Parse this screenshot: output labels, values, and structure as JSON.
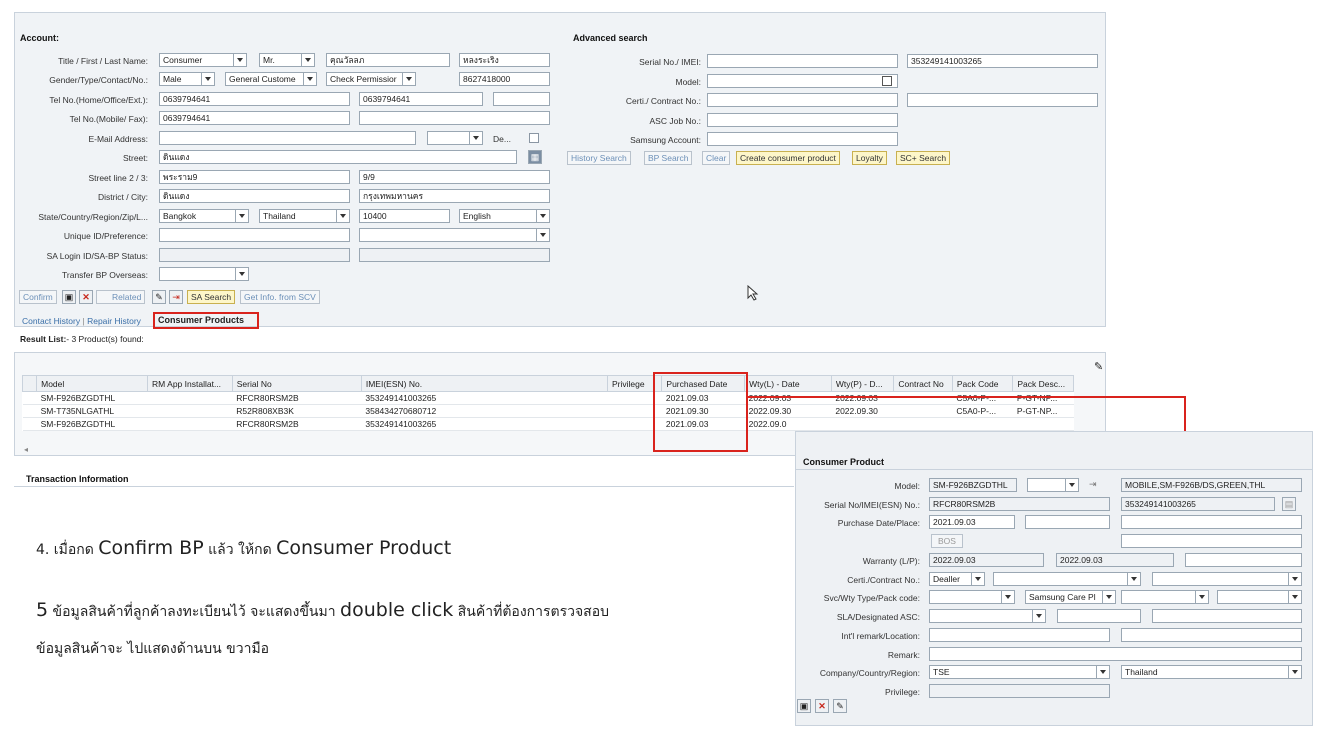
{
  "account": {
    "header": "Account:",
    "rows": [
      {
        "label": "Title / First / Last Name:"
      },
      {
        "label": "Gender/Type/Contact/No.:"
      },
      {
        "label": "Tel No.(Home/Office/Ext.):"
      },
      {
        "label": "Tel No.(Mobile/ Fax):"
      },
      {
        "label": "E-Mail Address:"
      },
      {
        "label": "Street:"
      },
      {
        "label": "Street line 2 / 3:"
      },
      {
        "label": "District / City:"
      },
      {
        "label": "State/Country/Region/Zip/L..."
      },
      {
        "label": "Unique ID/Preference:"
      },
      {
        "label": "SA Login ID/SA-BP Status:"
      },
      {
        "label": "Transfer BP Overseas:"
      }
    ],
    "title": "Consumer",
    "salutation": "Mr.",
    "first_name": "คุณวัลลภ",
    "last_name": "หลงระเริง",
    "gender": "Male",
    "type": "General Custome",
    "contact": "Check Permissior",
    "number": "8627418000",
    "tel_home": "0639794641",
    "tel_office": "0639794641",
    "tel_mobile": "0639794641",
    "email_de": "De...",
    "street": "ดินแดง",
    "street2": "พระราม9",
    "street3": "9/9",
    "district": "ดินแดง",
    "city": "กรุงเทพมหานคร",
    "state": "Bangkok",
    "country": "Thailand",
    "zip": "10400",
    "language": "English"
  },
  "toolbar": {
    "confirm": "Confirm",
    "related": "Related",
    "sa_search": "SA Search",
    "get_info": "Get Info. from SCV"
  },
  "advanced": {
    "header": "Advanced search",
    "labels": [
      "Serial No./ IMEI:",
      "Model:",
      "Certi./ Contract No.:",
      "ASC Job No.:",
      "Samsung Account:"
    ],
    "imei": "353249141003265",
    "buttons": [
      "History Search",
      "BP Search",
      "Clear",
      "Create consumer product",
      "Loyalty",
      "SC+ Search"
    ]
  },
  "tabs": {
    "contact_history": "Contact History",
    "sep": "|",
    "repair_history": "Repair History",
    "consumer_products": "Consumer Products"
  },
  "result": {
    "label": "Result List:",
    "count_text": "- 3 Product(s) found:"
  },
  "table": {
    "columns": [
      "Model",
      "RM App Installat...",
      "Serial No",
      "IMEI(ESN) No.",
      "Privilege",
      "Purchased Date",
      "Wty(L) - Date",
      "Wty(P) - D...",
      "Contract No",
      "Pack Code",
      "Pack Desc..."
    ],
    "rows": [
      [
        "SM-F926BZGDTHL",
        "",
        "RFCR80RSM2B",
        "353249141003265",
        "",
        "2021.09.03",
        "2022.09.03",
        "2022.09.03",
        "",
        "C5A0-P-...",
        "P-GT-NP..."
      ],
      [
        "SM-T735NLGATHL",
        "",
        "R52R808XB3K",
        "358434270680712",
        "",
        "2021.09.30",
        "2022.09.30",
        "2022.09.30",
        "",
        "C5A0-P-...",
        "P-GT-NP..."
      ],
      [
        "SM-F926BZGDTHL",
        "",
        "RFCR80RSM2B",
        "353249141003265",
        "",
        "2021.09.03",
        "2022.09.0",
        "",
        "",
        "",
        ""
      ]
    ]
  },
  "transaction": {
    "header": "Transaction Information"
  },
  "instructions": {
    "step4_prefix": "4. เมื่อกด ",
    "step4_big1": "Confirm BP",
    "step4_mid": " แล้ว ให้กด ",
    "step4_big2": "Consumer Product",
    "step5_num": "5",
    "step5_text": " ข้อมูลสินค้าที่ลูกค้าลงทะเบียนไว้ จะแสดงขึ้นมา ",
    "step5_big": "double click",
    "step5_tail": " สินค้าที่ต้องการตรวจสอบ",
    "step5_line2": "ข้อมูลสินค้าจะ ไปแสดงด้านบน ขวามือ"
  },
  "consumer_product": {
    "header": "Consumer Product",
    "labels": [
      "Model:",
      "Serial No/IMEI(ESN) No.:",
      "Purchase Date/Place:",
      "",
      "Warranty (L/P):",
      "Certi./Contract No.:",
      "Svc/Wty Type/Pack code:",
      "SLA/Designated ASC:",
      "Int'l remark/Location:",
      "Remark:",
      "Company/Country/Region:",
      "Privilege:"
    ],
    "model": "SM-F926BZGDTHL",
    "model_desc": "MOBILE,SM-F926B/DS,GREEN,THL",
    "serial": "RFCR80RSM2B",
    "imei": "353249141003265",
    "purchase_date": "2021.09.03",
    "bos": "BOS",
    "warranty_l": "2022.09.03",
    "warranty_p": "2022.09.03",
    "certi": "Dealler",
    "pack": "Samsung Care Pl",
    "company": "TSE",
    "country": "Thailand"
  },
  "colors": {
    "highlight": "#d9231d",
    "panel": "#f0f3f6",
    "button_yellow": "#fdf6c9"
  }
}
